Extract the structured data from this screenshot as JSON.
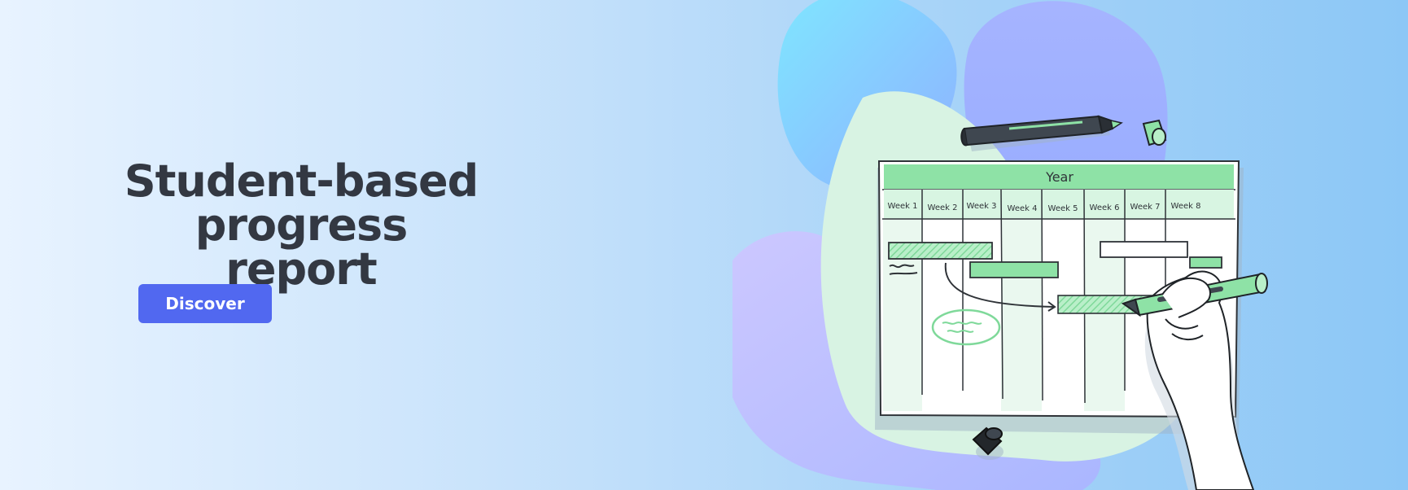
{
  "hero": {
    "title_line1": "Student-based",
    "title_line2": "progress report",
    "button_label": "Discover"
  },
  "illustration": {
    "chart_header": "Year",
    "weeks": [
      "Week 1",
      "Week 2",
      "Week 3",
      "Week 4",
      "Week 5",
      "Week 6",
      "Week 7",
      "Week 8"
    ]
  },
  "colors": {
    "button": "#5168f0",
    "title": "#333842",
    "accent_green": "#8ee2a6"
  }
}
